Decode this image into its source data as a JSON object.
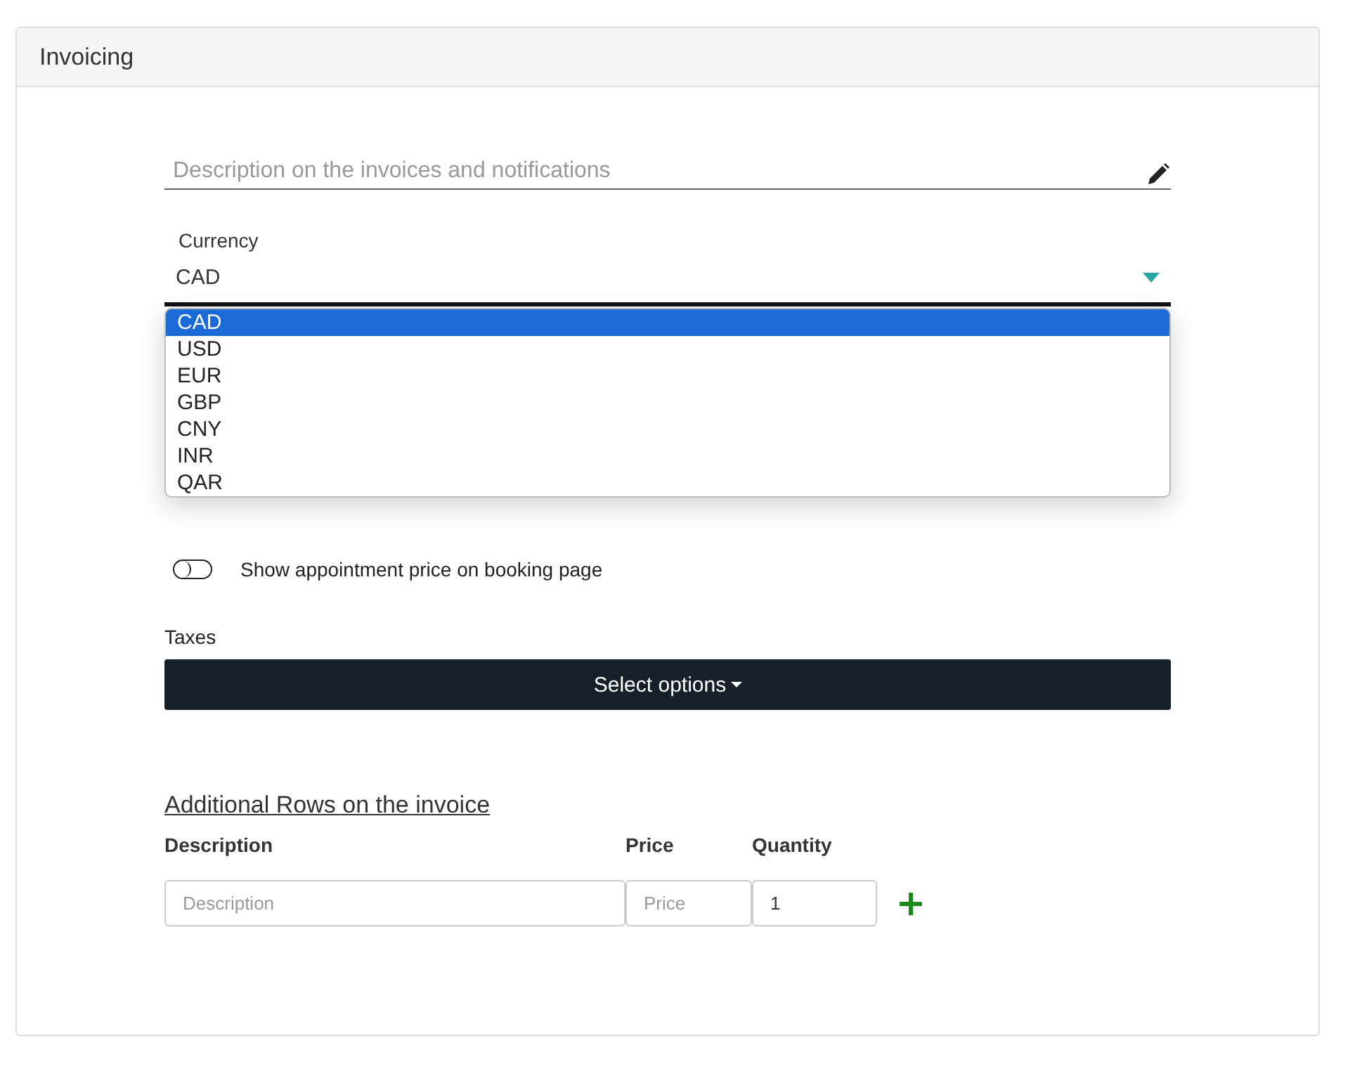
{
  "panel": {
    "title": "Invoicing"
  },
  "description_field": {
    "placeholder": "Description on the invoices and notifications"
  },
  "currency": {
    "label": "Currency",
    "value": "CAD",
    "expanded": true,
    "options": [
      {
        "label": "CAD",
        "selected": true
      },
      {
        "label": "USD",
        "selected": false
      },
      {
        "label": "EUR",
        "selected": false
      },
      {
        "label": "GBP",
        "selected": false
      },
      {
        "label": "CNY",
        "selected": false
      },
      {
        "label": "INR",
        "selected": false
      },
      {
        "label": "QAR",
        "selected": false
      }
    ]
  },
  "show_price_toggle": {
    "label": "Show appointment price on booking page",
    "on": false
  },
  "taxes": {
    "label": "Taxes",
    "button": "Select options"
  },
  "additional_rows": {
    "heading": "Additional Rows on the invoice",
    "columns": [
      "Description",
      "Price",
      "Quantity"
    ],
    "inputs": [
      {
        "placeholder": "Description"
      },
      {
        "placeholder": "Price"
      },
      {
        "value": "1"
      }
    ]
  }
}
